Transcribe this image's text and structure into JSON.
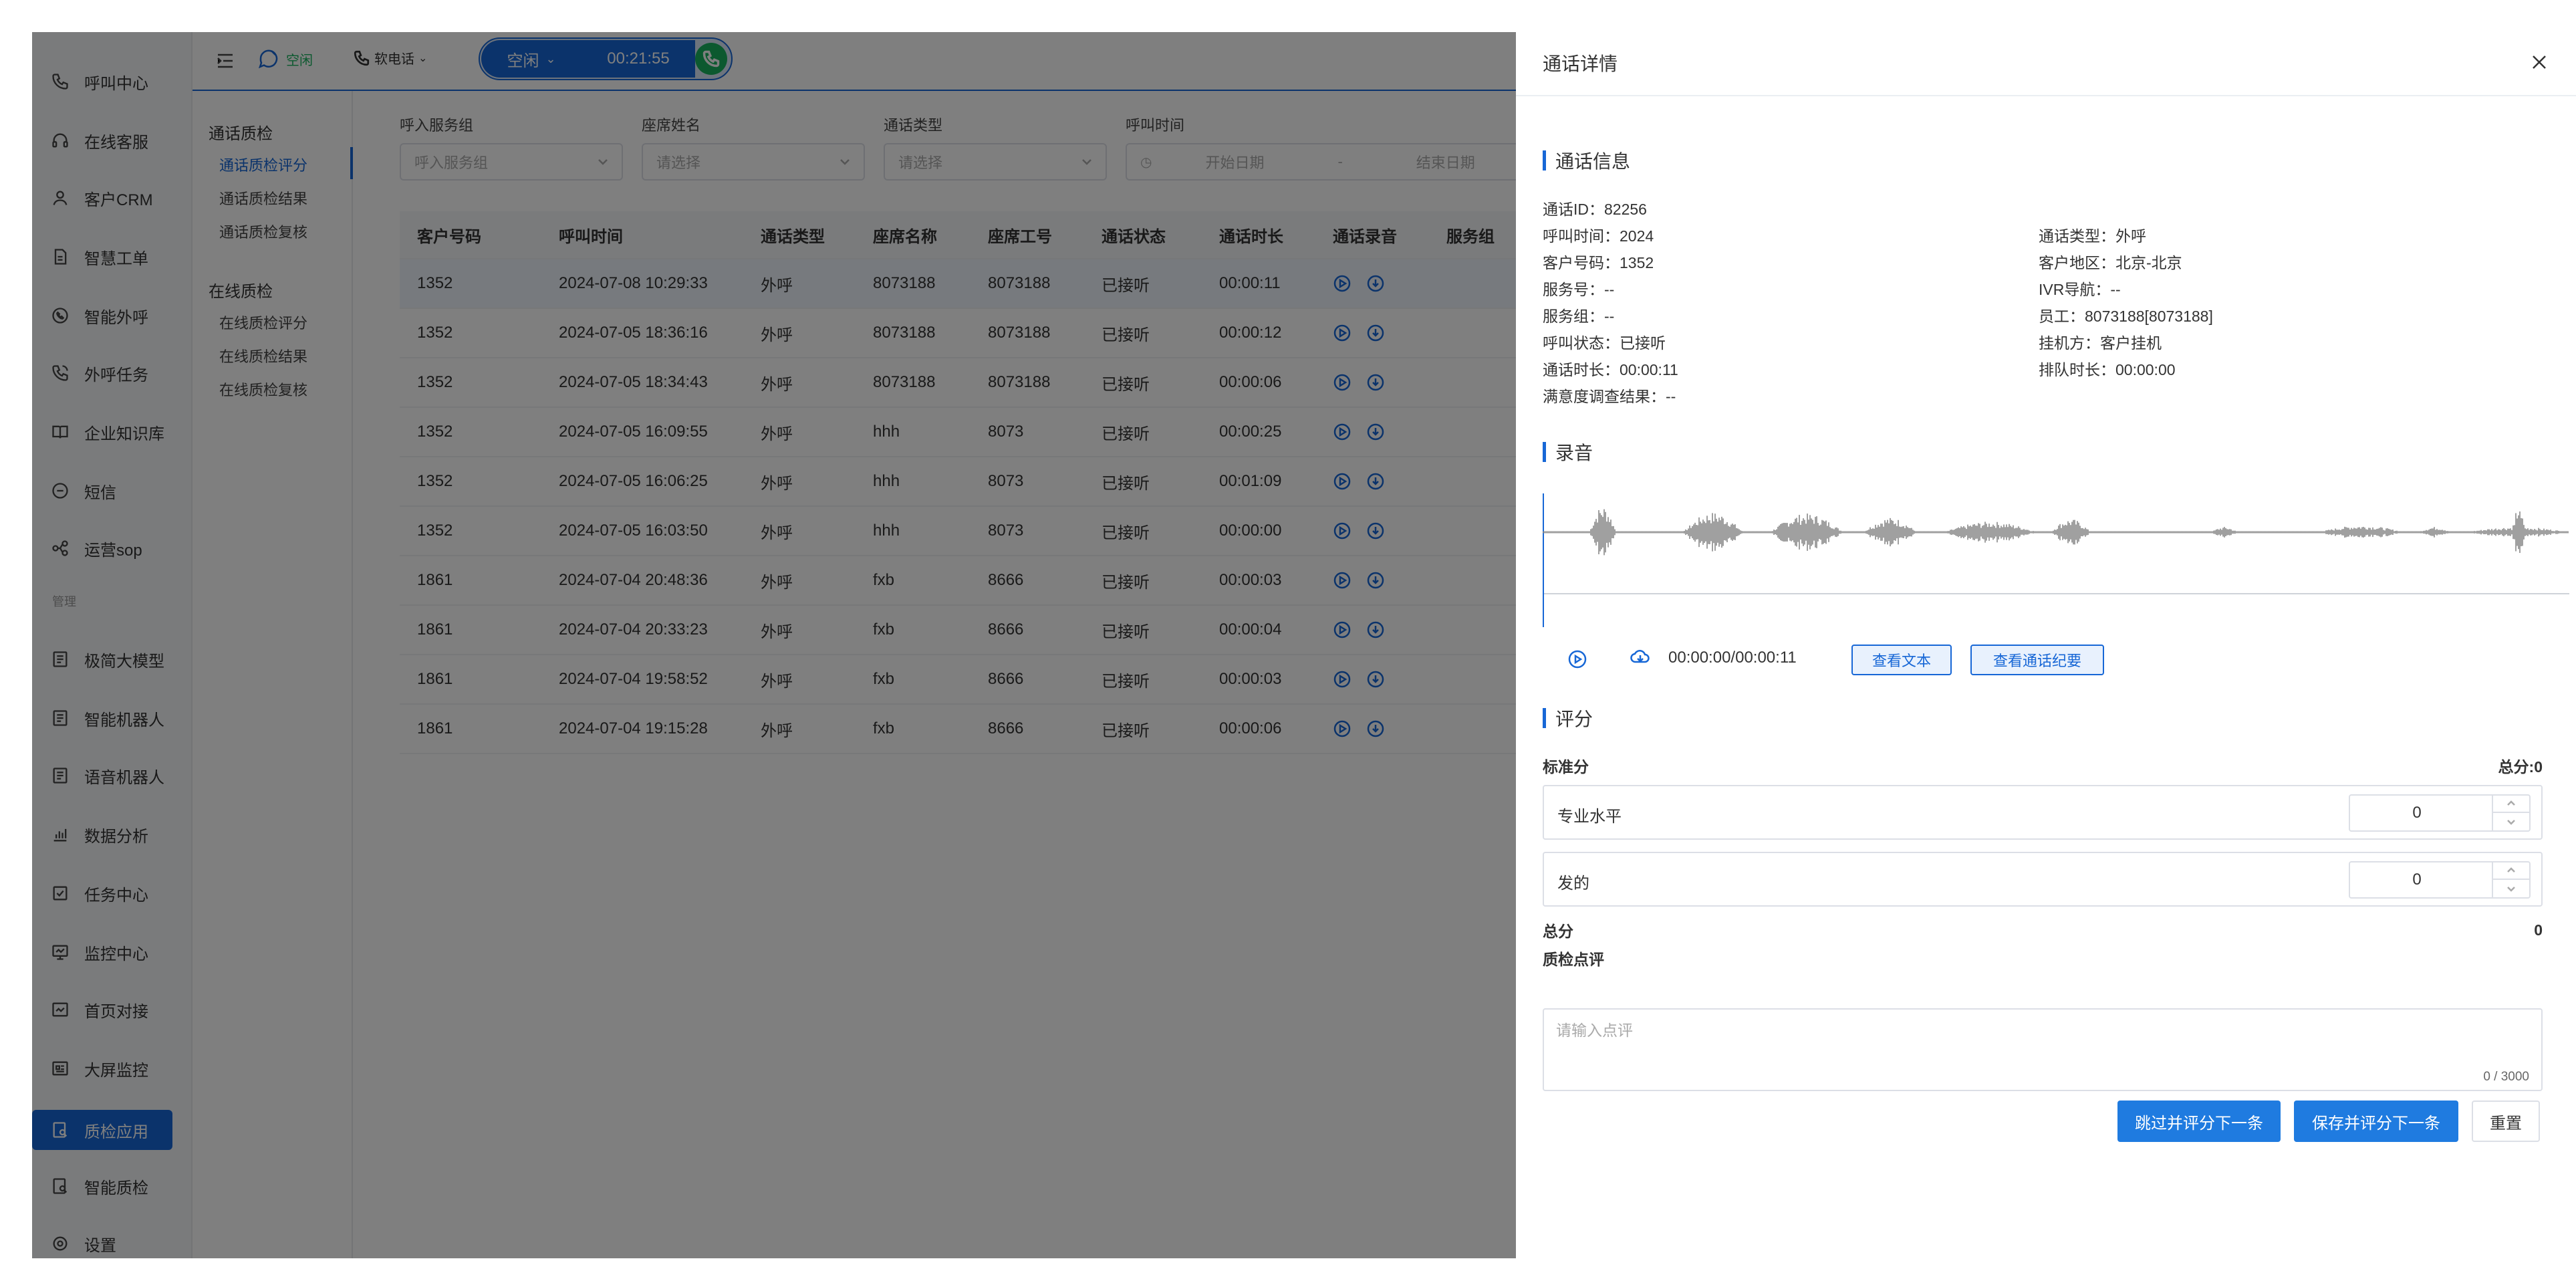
{
  "sidebar": {
    "items": [
      {
        "label": "呼叫中心",
        "icon": "phone-icon"
      },
      {
        "label": "在线客服",
        "icon": "headset-icon"
      },
      {
        "label": "客户CRM",
        "icon": "user-icon"
      },
      {
        "label": "智慧工单",
        "icon": "document-icon"
      },
      {
        "label": "智能外呼",
        "icon": "whatsapp-phone-icon"
      },
      {
        "label": "外呼任务",
        "icon": "phone-call-icon"
      },
      {
        "label": "企业知识库",
        "icon": "book-icon"
      },
      {
        "label": "短信",
        "icon": "message-icon"
      },
      {
        "label": "运营sop",
        "icon": "flow-icon"
      }
    ],
    "group_label": "管理",
    "items2": [
      {
        "label": "极简大模型",
        "icon": "model-icon"
      },
      {
        "label": "智能机器人",
        "icon": "robot-icon"
      },
      {
        "label": "语音机器人",
        "icon": "voice-robot-icon"
      },
      {
        "label": "数据分析",
        "icon": "bar-chart-icon"
      },
      {
        "label": "任务中心",
        "icon": "task-icon"
      },
      {
        "label": "监控中心",
        "icon": "monitor-icon"
      },
      {
        "label": "首页对接",
        "icon": "home-link-icon"
      },
      {
        "label": "大屏监控",
        "icon": "big-screen-icon"
      },
      {
        "label": "质检应用",
        "icon": "qc-app-icon"
      },
      {
        "label": "智能质检",
        "icon": "smart-qc-icon"
      },
      {
        "label": "设置",
        "icon": "gear-icon"
      }
    ]
  },
  "topbar": {
    "status_text": "空闲",
    "soft_phone": "软电话",
    "pill_status": "空闲",
    "pill_time": "00:21:55"
  },
  "subnav": {
    "group1": "通话质检",
    "group1_items": [
      "通话质检评分",
      "通话质检结果",
      "通话质检复核"
    ],
    "group2": "在线质检",
    "group2_items": [
      "在线质检评分",
      "在线质检结果",
      "在线质检复核"
    ]
  },
  "filters": {
    "service_group_label": "呼入服务组",
    "service_group_placeholder": "呼入服务组",
    "agent_name_label": "座席姓名",
    "agent_name_placeholder": "请选择",
    "call_type_label": "通话类型",
    "call_type_placeholder": "请选择",
    "call_time_label": "呼叫时间",
    "start_placeholder": "开始日期",
    "range_sep": "-",
    "end_placeholder": "结束日期"
  },
  "table": {
    "headers": [
      "客户号码",
      "呼叫时间",
      "通话类型",
      "座席名称",
      "座席工号",
      "通话状态",
      "通话时长",
      "通话录音",
      "服务组"
    ],
    "rows": [
      [
        "1352",
        "2024-07-08 10:29:33",
        "外呼",
        "8073188",
        "8073188",
        "已接听",
        "00:00:11"
      ],
      [
        "1352",
        "2024-07-05 18:36:16",
        "外呼",
        "8073188",
        "8073188",
        "已接听",
        "00:00:12"
      ],
      [
        "1352",
        "2024-07-05 18:34:43",
        "外呼",
        "8073188",
        "8073188",
        "已接听",
        "00:00:06"
      ],
      [
        "1352",
        "2024-07-05 16:09:55",
        "外呼",
        "hhh",
        "8073",
        "已接听",
        "00:00:25"
      ],
      [
        "1352",
        "2024-07-05 16:06:25",
        "外呼",
        "hhh",
        "8073",
        "已接听",
        "00:01:09"
      ],
      [
        "1352",
        "2024-07-05 16:03:50",
        "外呼",
        "hhh",
        "8073",
        "已接听",
        "00:00:00"
      ],
      [
        "1861",
        "2024-07-04 20:48:36",
        "外呼",
        "fxb",
        "8666",
        "已接听",
        "00:00:03"
      ],
      [
        "1861",
        "2024-07-04 20:33:23",
        "外呼",
        "fxb",
        "8666",
        "已接听",
        "00:00:04"
      ],
      [
        "1861",
        "2024-07-04 19:58:52",
        "外呼",
        "fxb",
        "8666",
        "已接听",
        "00:00:03"
      ],
      [
        "1861",
        "2024-07-04 19:15:28",
        "外呼",
        "fxb",
        "8666",
        "已接听",
        "00:00:06"
      ]
    ]
  },
  "drawer": {
    "title": "通话详情",
    "info_title": "通话信息",
    "call_id": "通话ID：82256",
    "call_time": "呼叫时间：2024",
    "call_type": "通话类型：外呼",
    "customer_no": "客户号码：1352",
    "customer_region": "客户地区：北京-北京",
    "service_no": "服务号：--",
    "ivr": "IVR导航：--",
    "service_group": "服务组：--",
    "staff": "员工：8073188[8073188]",
    "call_status": "呼叫状态：已接听",
    "hangup": "挂机方：客户挂机",
    "duration": "通话时长：00:00:11",
    "queue": "排队时长：00:00:00",
    "satisfaction": "满意度调查结果：--",
    "record_title": "录音",
    "player_time": "00:00:00/00:00:11",
    "view_text": "查看文本",
    "view_summary": "查看通话纪要",
    "score_title": "评分",
    "std_score": "标准分",
    "total_score_label": "总分:0",
    "items": [
      {
        "name": "专业水平",
        "value": "0"
      },
      {
        "name": "发的",
        "value": "0"
      }
    ],
    "total_label": "总分",
    "total_value": "0",
    "comment_label": "质检点评",
    "comment_placeholder": "请输入点评",
    "comment_count": "0 / 3000",
    "skip_btn": "跳过并评分下一条",
    "save_btn": "保存并评分下一条",
    "reset_btn": "重置"
  },
  "colors": {
    "primary": "#1767d6",
    "success": "#19b25e",
    "waveform": "#888888"
  }
}
